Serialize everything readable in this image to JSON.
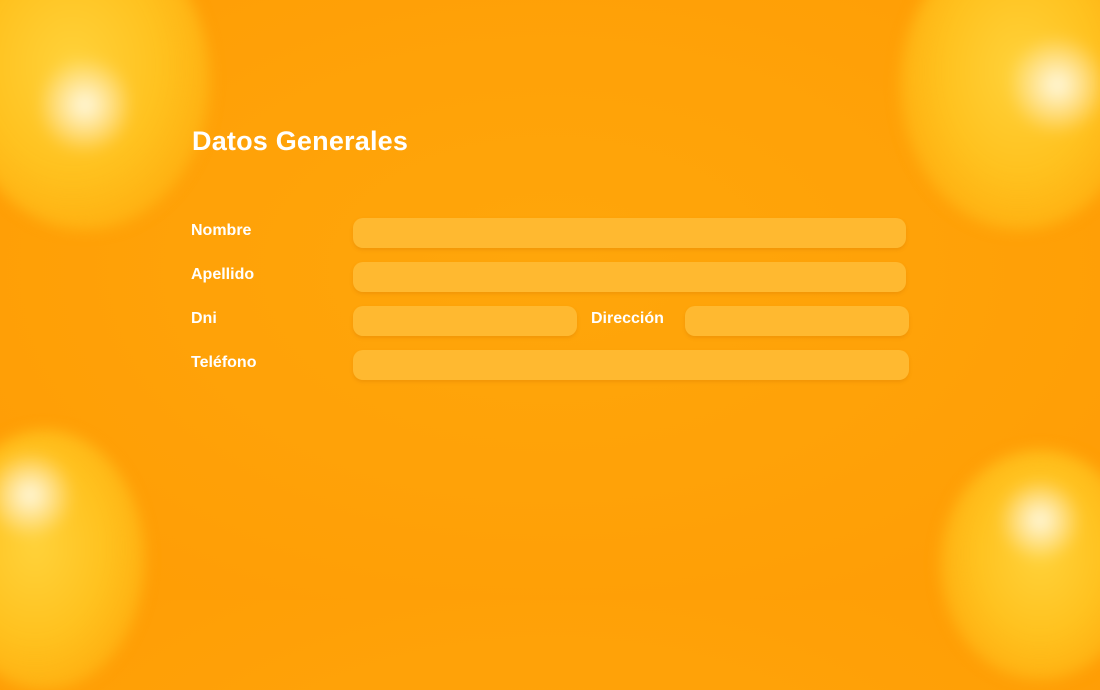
{
  "form": {
    "title": "Datos Generales",
    "fields": {
      "nombre": {
        "label": "Nombre",
        "value": ""
      },
      "apellido": {
        "label": "Apellido",
        "value": ""
      },
      "dni": {
        "label": "Dni",
        "value": ""
      },
      "direccion": {
        "label": "Dirección",
        "value": ""
      },
      "telefono": {
        "label": "Teléfono",
        "value": ""
      }
    }
  },
  "colors": {
    "background": "#ffa208",
    "field_fill": "#ffb930",
    "text": "#ffffff"
  }
}
